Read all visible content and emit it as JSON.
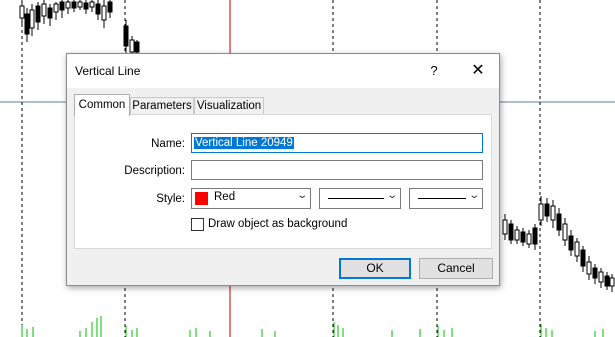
{
  "dialog": {
    "title": "Vertical Line",
    "help_label": "?",
    "close_label": "✕",
    "tabs": [
      {
        "label": "Common"
      },
      {
        "label": "Parameters"
      },
      {
        "label": "Visualization"
      }
    ],
    "active_tab": "Common",
    "name_label": "Name:",
    "name_value": "Vertical Line 20949",
    "description_label": "Description:",
    "description_value": "",
    "style_label": "Style:",
    "color_name": "Red",
    "color_hex": "#ff0000",
    "draw_background_label": "Draw object as background",
    "draw_background_checked": false,
    "ok_label": "OK",
    "cancel_label": "Cancel"
  },
  "chart": {
    "background": "#ffffff",
    "candle_color": "#000000",
    "volume_color": "#00c000",
    "selected_line_color": "#cc0000",
    "horizontal_line_color": "#5b7fa6"
  }
}
